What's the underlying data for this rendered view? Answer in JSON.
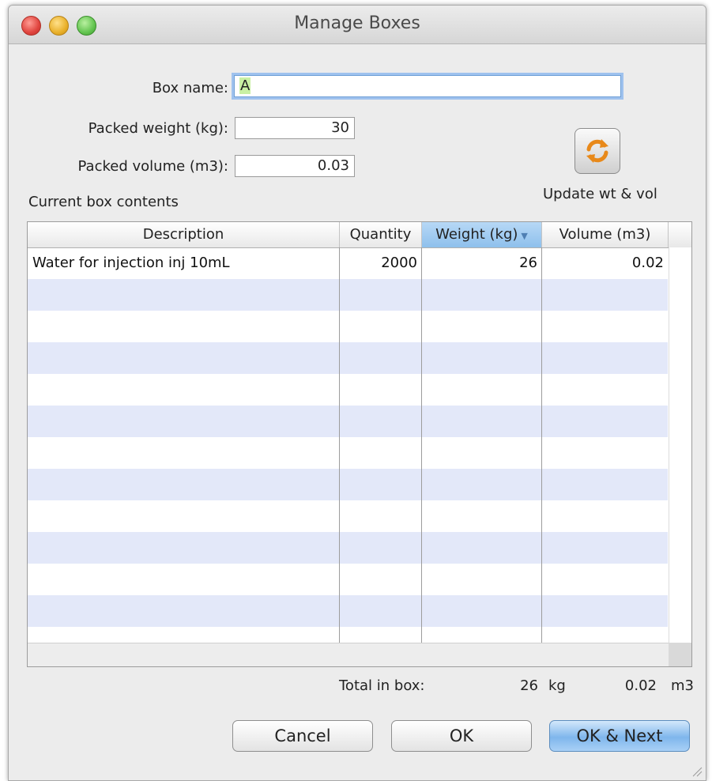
{
  "window": {
    "title": "Manage Boxes"
  },
  "form": {
    "box_name_label": "Box name:",
    "box_name_value": "A",
    "packed_weight_label": "Packed weight (kg):",
    "packed_weight_value": "30",
    "packed_volume_label": "Packed volume (m3):",
    "packed_volume_value": "0.03"
  },
  "update_button": {
    "label": "Update wt & vol",
    "icon": "refresh-icon"
  },
  "contents": {
    "label": "Current box contents",
    "columns": [
      "Description",
      "Quantity",
      "Weight (kg)",
      "Volume (m3)"
    ],
    "sorted_column": "Weight (kg)",
    "rows": [
      {
        "description": "Water for injection inj 10mL",
        "quantity": "2000",
        "weight": "26",
        "volume": "0.02"
      }
    ]
  },
  "totals": {
    "label": "Total in box:",
    "weight": "26",
    "weight_unit": "kg",
    "volume": "0.02",
    "volume_unit": "m3"
  },
  "buttons": {
    "cancel": "Cancel",
    "ok": "OK",
    "ok_next": "OK & Next"
  },
  "colors": {
    "stripe": "#e3e8f9",
    "default_button": "#7fb6ec",
    "sorted_header": "#8ec0ec",
    "focus_ring": "#9fc2ee"
  }
}
